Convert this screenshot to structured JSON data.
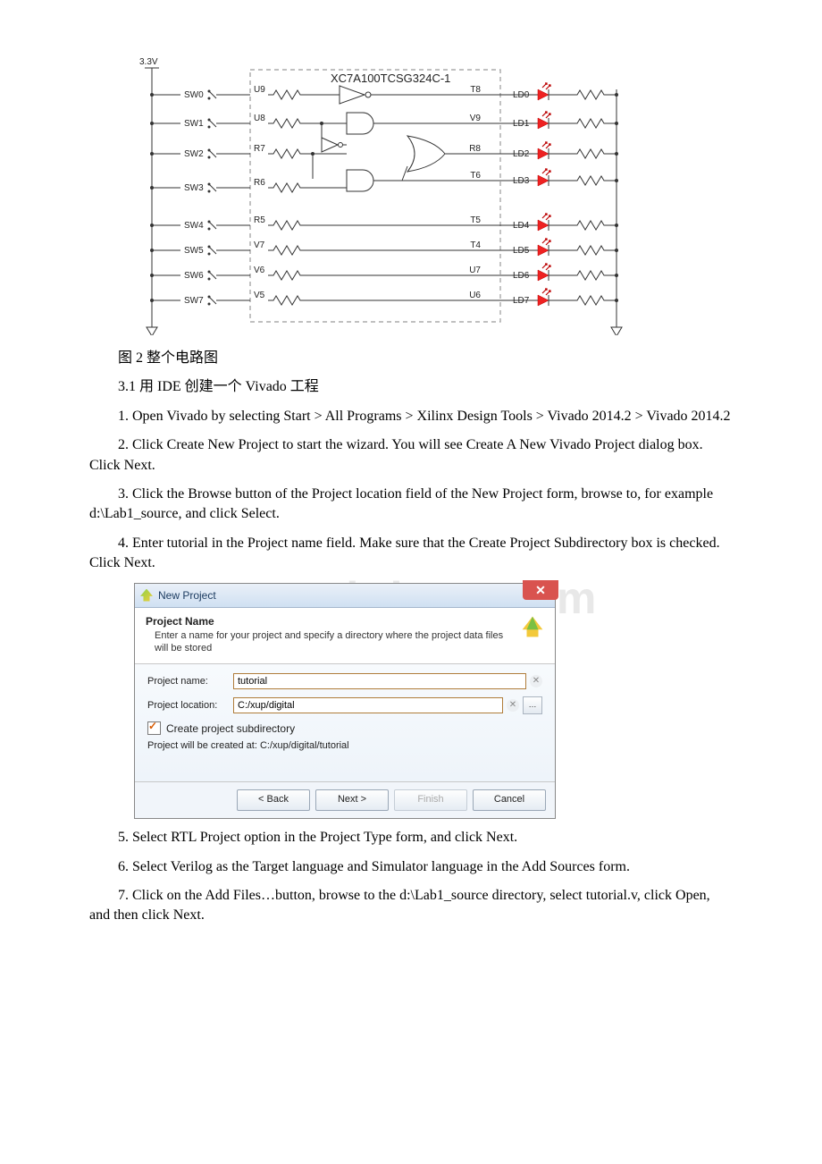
{
  "circuit": {
    "chip_label": "XC7A100TCSG324C-1",
    "power_label": "3.3V",
    "rows": [
      {
        "sw": "SW0",
        "pin_in": "U9",
        "pin_out": "T8",
        "led": "LD0"
      },
      {
        "sw": "SW1",
        "pin_in": "U8",
        "pin_out": "V9",
        "led": "LD1"
      },
      {
        "sw": "SW2",
        "pin_in": "R7",
        "pin_out": "R8",
        "led": "LD2"
      },
      {
        "sw": "SW3",
        "pin_in": "R6",
        "pin_out": "T6",
        "led": "LD3"
      },
      {
        "sw": "SW4",
        "pin_in": "R5",
        "pin_out": "T5",
        "led": "LD4"
      },
      {
        "sw": "SW5",
        "pin_in": "V7",
        "pin_out": "T4",
        "led": "LD5"
      },
      {
        "sw": "SW6",
        "pin_in": "V6",
        "pin_out": "U7",
        "led": "LD6"
      },
      {
        "sw": "SW7",
        "pin_in": "V5",
        "pin_out": "U6",
        "led": "LD7"
      }
    ]
  },
  "captions": {
    "fig2": "图 2 整个电路图",
    "sec31": "3.1 用 IDE 创建一个 Vivado 工程"
  },
  "steps": {
    "s1": "1. Open Vivado by selecting Start > All Programs > Xilinx Design Tools > Vivado 2014.2 > Vivado 2014.2",
    "s2": "2. Click Create New Project to start the wizard. You will see Create A New Vivado Project dialog box. Click Next.",
    "s3": "3. Click the Browse button of the Project location field of the New Project form, browse to, for example d:\\Lab1_source, and click Select.",
    "s4": "4. Enter tutorial in the Project name field. Make sure that the Create Project Subdirectory box is checked. Click Next.",
    "s5": "5. Select RTL Project option in the Project Type form, and click Next.",
    "s6": "6. Select Verilog as the Target language and Simulator language in the Add Sources form.",
    "s7": "7. Click on the Add Files…button, browse to the d:\\Lab1_source directory, select tutorial.v, click Open, and then click Next."
  },
  "dialog": {
    "window_title": "New Project",
    "close_glyph": "✕",
    "header_title": "Project Name",
    "header_desc": "Enter a name for your project and specify a directory where the project data files will be stored",
    "name_label": "Project name:",
    "name_value": "tutorial",
    "loc_label": "Project location:",
    "loc_value": "C:/xup/digital",
    "browse_glyph": "…",
    "chk_label": "Create project subdirectory",
    "path_note": "Project will be created at: C:/xup/digital/tutorial",
    "btn_back": "< Back",
    "btn_next": "Next >",
    "btn_finish": "Finish",
    "btn_cancel": "Cancel"
  },
  "watermark": "www.bdocx.com"
}
